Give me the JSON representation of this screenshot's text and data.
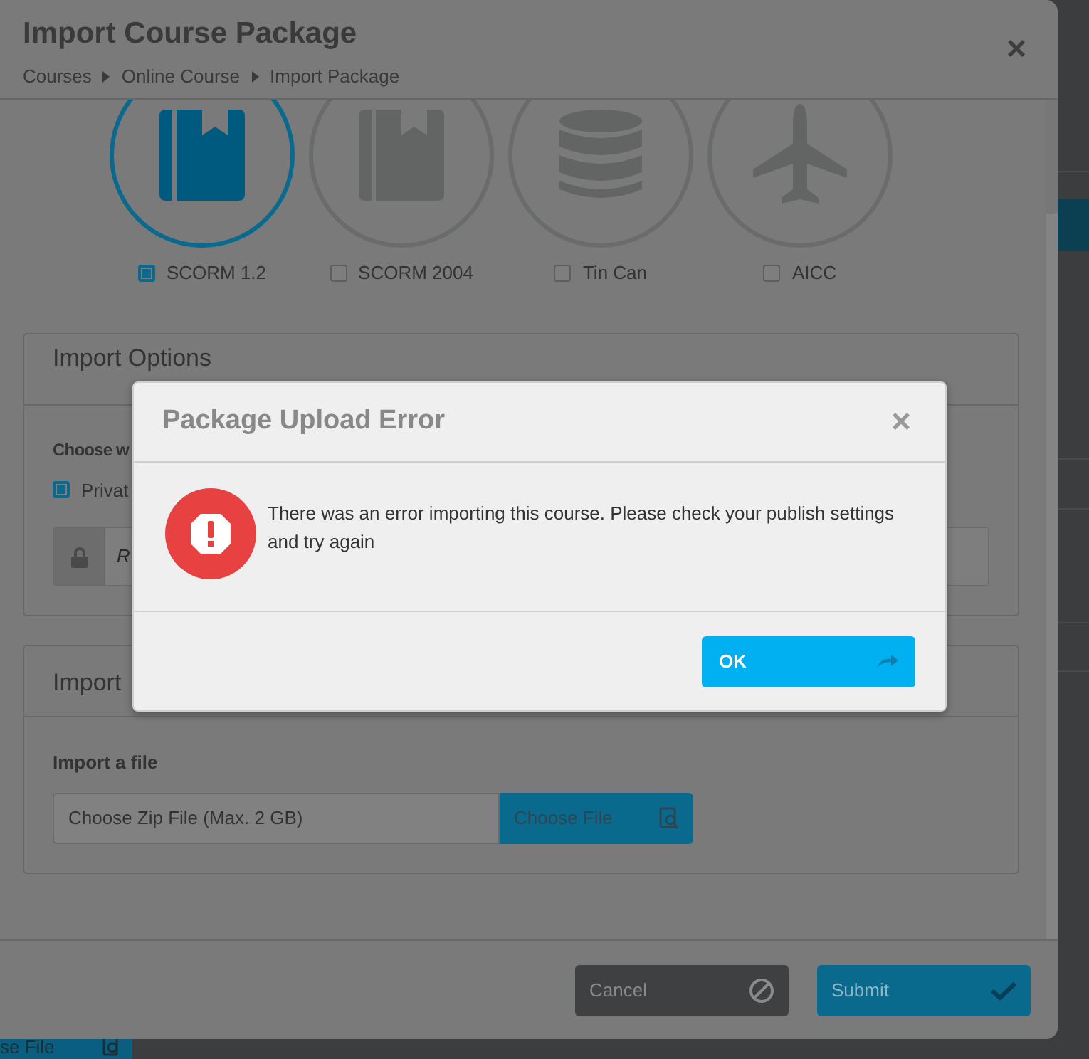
{
  "background_page": {
    "button_text": "se File"
  },
  "import_window": {
    "title": "Import Course Package",
    "breadcrumb": [
      "Courses",
      "Online Course",
      "Import Package"
    ],
    "close": "×",
    "formats": [
      {
        "label": "SCORM 1.2",
        "selected": true
      },
      {
        "label": "SCORM 2004",
        "selected": false
      },
      {
        "label": "Tin Can",
        "selected": false
      },
      {
        "label": "AICC",
        "selected": false
      }
    ],
    "options_panel": {
      "title": "Import Options",
      "question": "Choose w",
      "choice": {
        "label": "Privat",
        "checked": true
      },
      "field_placeholder": "R"
    },
    "file_panel": {
      "title": "Import",
      "field_label": "Import a file",
      "file_field": "Choose Zip File (Max. 2 GB)",
      "choose_button": "Choose File"
    },
    "buttons": [
      {
        "label": "Cancel",
        "kind": "cancel"
      },
      {
        "label": "Submit",
        "kind": "submit"
      }
    ]
  },
  "error_dialog": {
    "title": "Package Upload Error",
    "close": "×",
    "message": "There was an error importing this course. Please check your publish settings and try again",
    "ok_button": "OK"
  }
}
